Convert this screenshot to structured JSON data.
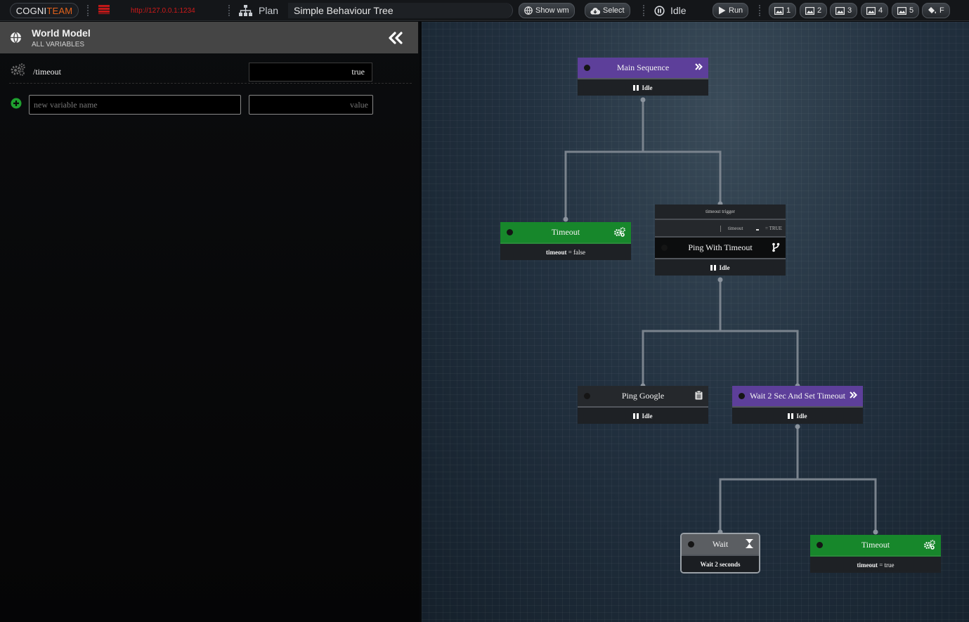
{
  "topbar": {
    "logo_a": "COGNI",
    "logo_b": "TEAM",
    "url": "http://127.0.0.1:1234",
    "plan_label": "Plan",
    "tree_title": "Simple Behaviour Tree",
    "show_wm_label": "Show wm",
    "select_label": "Select",
    "status_label": "Idle",
    "run_label": "Run",
    "slots": [
      "1",
      "2",
      "3",
      "4",
      "5"
    ],
    "last_label": "F"
  },
  "world_model": {
    "title": "World Model",
    "subtitle": "ALL VARIABLES",
    "variables": [
      {
        "name": "/timeout",
        "value": "true"
      }
    ],
    "new_name_placeholder": "new variable name",
    "new_value_placeholder": "value"
  },
  "tree": {
    "main_sequence": {
      "label": "Main Sequence",
      "status": "Idle"
    },
    "timeout_1": {
      "label": "Timeout",
      "body_key": "timeout",
      "body_rest": " = false"
    },
    "ping_with_timeout": {
      "decorator_label": "timeout trigger",
      "decorator_key": "timeout",
      "decorator_value": "= TRUE",
      "label": "Ping With Timeout",
      "status": "Idle"
    },
    "ping_google": {
      "label": "Ping Google",
      "status": "Idle"
    },
    "wait_and_set": {
      "label": "Wait 2 Sec And Set Timeout",
      "status": "Idle"
    },
    "wait": {
      "label": "Wait",
      "body": "Wait 2 seconds"
    },
    "timeout_2": {
      "label": "Timeout",
      "body_key": "timeout",
      "body_rest": " = true"
    }
  },
  "colors": {
    "sequence": "#5d3f9a",
    "action_green": "#17872b",
    "accent_orange": "#e2621b",
    "url_red": "#d01a1a"
  }
}
